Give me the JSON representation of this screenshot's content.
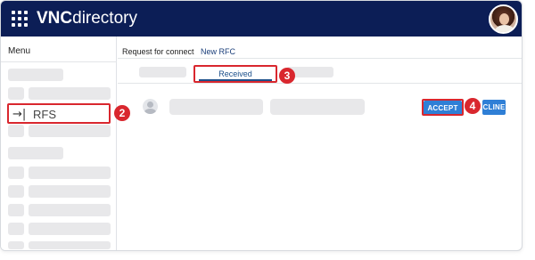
{
  "header": {
    "brand_bold": "VNC",
    "brand_regular": "directory"
  },
  "sidebar": {
    "menu_label": "Menu",
    "selected_item": {
      "icon": "→|",
      "label": "RFS"
    }
  },
  "main": {
    "tabs": [
      {
        "label": "Request for connect",
        "color": "#222222"
      },
      {
        "label": "New RFC",
        "color": "#1b3f7a"
      }
    ],
    "sub_tab_selected": "Received",
    "row": {
      "accept_label": "ACCEPT",
      "decline_label": "CLINE"
    }
  },
  "callouts": {
    "step2": "2",
    "step3": "3",
    "step4": "4"
  },
  "colors": {
    "header_bg": "#0c1e56",
    "callout_red": "#d9272e",
    "button_blue": "#2f7fd6",
    "tab_blue": "#1b4f8a"
  }
}
